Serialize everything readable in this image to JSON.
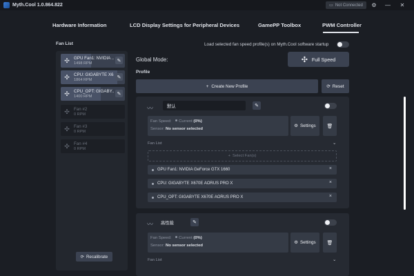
{
  "window": {
    "title": "Myth.Cool  1.0.864.822",
    "status": "Not Connected",
    "controls": [
      "gear-icon",
      "minimize-icon",
      "close-icon"
    ]
  },
  "tabs": [
    {
      "label": "Hardware Information"
    },
    {
      "label": "LCD Display Settings for Peripheral Devices"
    },
    {
      "label": "GamePP Toolbox"
    },
    {
      "label": "PWM Controller",
      "active": true
    }
  ],
  "fan_list": {
    "title": "Fan List",
    "items": [
      {
        "name": "GPU Fan1: NVIDIA ...",
        "rpm": "1498 RPM",
        "active": true,
        "level": 0.47
      },
      {
        "name": "CPU: GIGABYTE X6...",
        "rpm": "1864 RPM",
        "active": true,
        "level": 0.88
      },
      {
        "name": "CPU_OPT: GIGABY...",
        "rpm": "1400 RPM",
        "active": true,
        "level": 0.62
      },
      {
        "name": "Fan #2",
        "rpm": "0 RPM",
        "active": false
      },
      {
        "name": "Fan #3",
        "rpm": "0 RPM",
        "active": false
      },
      {
        "name": "Fan #4",
        "rpm": "0 RPM",
        "active": false
      }
    ],
    "recalibrate_label": "Recalibrate"
  },
  "main": {
    "startup_label": "Load selected fan speed profile(s) on Myth.Cool software startup",
    "global_mode_label": "Global Mode:",
    "full_speed_label": "Full Speed",
    "profile_label": "Profile",
    "create_label": "Create New Profile",
    "reset_label": "Reset"
  },
  "profiles": [
    {
      "name": "默认",
      "fan_speed_label": "Fan Speed:",
      "current_label": "Current",
      "current_value": "(0%)",
      "sensor_label": "Sensor:",
      "sensor_value": "No sensor selected",
      "settings_label": "Settings",
      "fan_list_label": "Fan List",
      "select_fans_label": "Select Fan(s)",
      "assigned_fans": [
        "GPU Fan1: NVIDIA GeForce GTX 1660",
        "CPU: GIGABYTE X670E AORUS PRO X",
        "CPU_OPT: GIGABYTE X670E AORUS PRO X"
      ]
    },
    {
      "name": "高性能",
      "fan_speed_label": "Fan Speed:",
      "current_label": "Current",
      "current_value": "(0%)",
      "sensor_label": "Sensor:",
      "sensor_value": "No sensor selected",
      "settings_label": "Settings",
      "fan_list_label": "Fan List"
    }
  ]
}
